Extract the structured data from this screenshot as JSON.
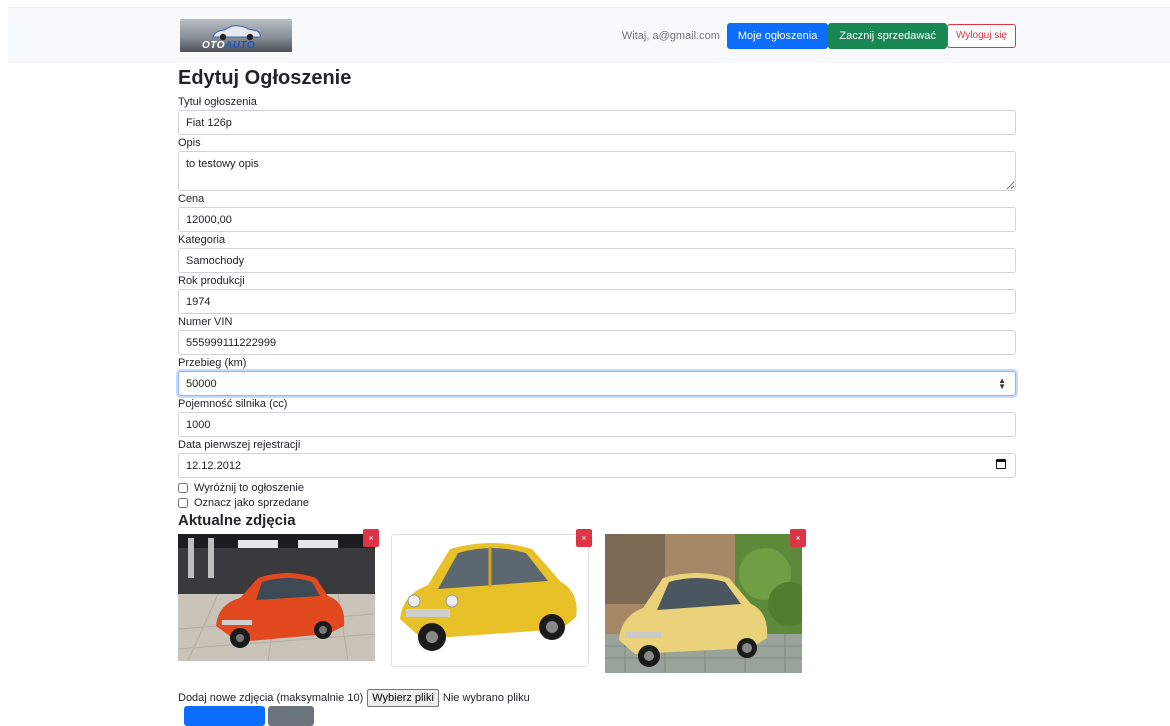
{
  "header": {
    "logo_text_main": "OTO",
    "logo_text_accent": "AUTO",
    "welcome": "Witaj, a@gmail.com",
    "my_listings": "Moje ogłoszenia",
    "start_selling": "Zacznij sprzedawać",
    "logout": "Wyloguj się"
  },
  "page": {
    "title": "Edytuj Ogłoszenie"
  },
  "form": {
    "title_label": "Tytuł ogłoszenia",
    "title_value": "Fiat 126p",
    "description_label": "Opis",
    "description_value": "to testowy opis",
    "price_label": "Cena",
    "price_value": "12000,00",
    "category_label": "Kategoria",
    "category_value": "Samochody",
    "year_label": "Rok produkcji",
    "year_value": "1974",
    "vin_label": "Numer VIN",
    "vin_value": "555999111222999",
    "mileage_label": "Przebieg (km)",
    "mileage_value": "50000",
    "engine_label": "Pojemność silnika (cc)",
    "engine_value": "1000",
    "registration_label": "Data pierwszej rejestracji",
    "registration_value": "12.12.2012",
    "featured_label": "Wyróżnij to ogłoszenie",
    "featured_checked": false,
    "sold_label": "Oznacz jako sprzedane",
    "sold_checked": false
  },
  "photos": {
    "heading": "Aktualne zdjęcia",
    "delete_symbol": "×",
    "items": [
      {
        "name": "orange-fiat-photo",
        "car_color": "#e2491e"
      },
      {
        "name": "yellow-fiat-photo-white-bg",
        "car_color": "#e8c028"
      },
      {
        "name": "yellow-fiat-photo-outdoor",
        "car_color": "#e9d27a"
      }
    ]
  },
  "upload": {
    "label": "Dodaj nowe zdjęcia (maksymalnie 10)",
    "choose_button": "Wybierz pliki",
    "no_file": "Nie wybrano pliku"
  },
  "colors": {
    "primary": "#0d6efd",
    "success": "#198754",
    "danger": "#dc3545",
    "secondary": "#6c757d"
  }
}
